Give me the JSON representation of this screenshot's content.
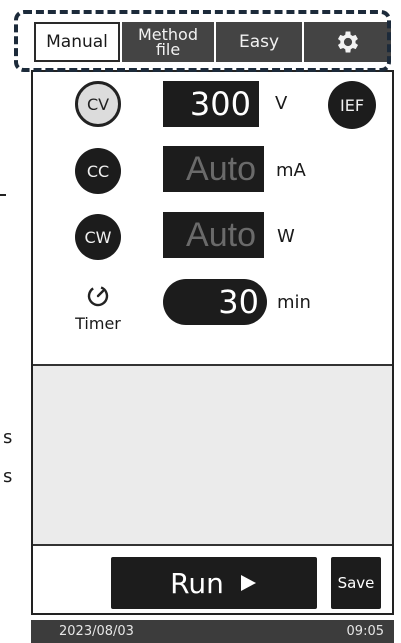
{
  "tabs": {
    "manual": "Manual",
    "method_line1": "Method",
    "method_line2": "file",
    "easy": "Easy",
    "settings_icon": "gear-icon"
  },
  "modes": {
    "cv": "CV",
    "cc": "CC",
    "cw": "CW",
    "ief": "IEF",
    "active": "CV"
  },
  "settings": {
    "voltage_value": "300",
    "voltage_unit": "V",
    "current_value": "Auto",
    "current_unit": "mA",
    "power_value": "Auto",
    "power_unit": "W",
    "timer_value": "30",
    "timer_unit": "min",
    "timer_label": "Timer"
  },
  "actions": {
    "run_label": "Run",
    "save_label": "Save"
  },
  "status": {
    "date": "2023/08/03",
    "time": "09:05"
  },
  "side_text": {
    "s1": "s",
    "s2": "s"
  },
  "colors": {
    "dark": "#1c1c1c",
    "tab_inactive": "#444444",
    "highlight_dashed": "#1c2a3a",
    "panel_gray": "#ebebeb"
  }
}
